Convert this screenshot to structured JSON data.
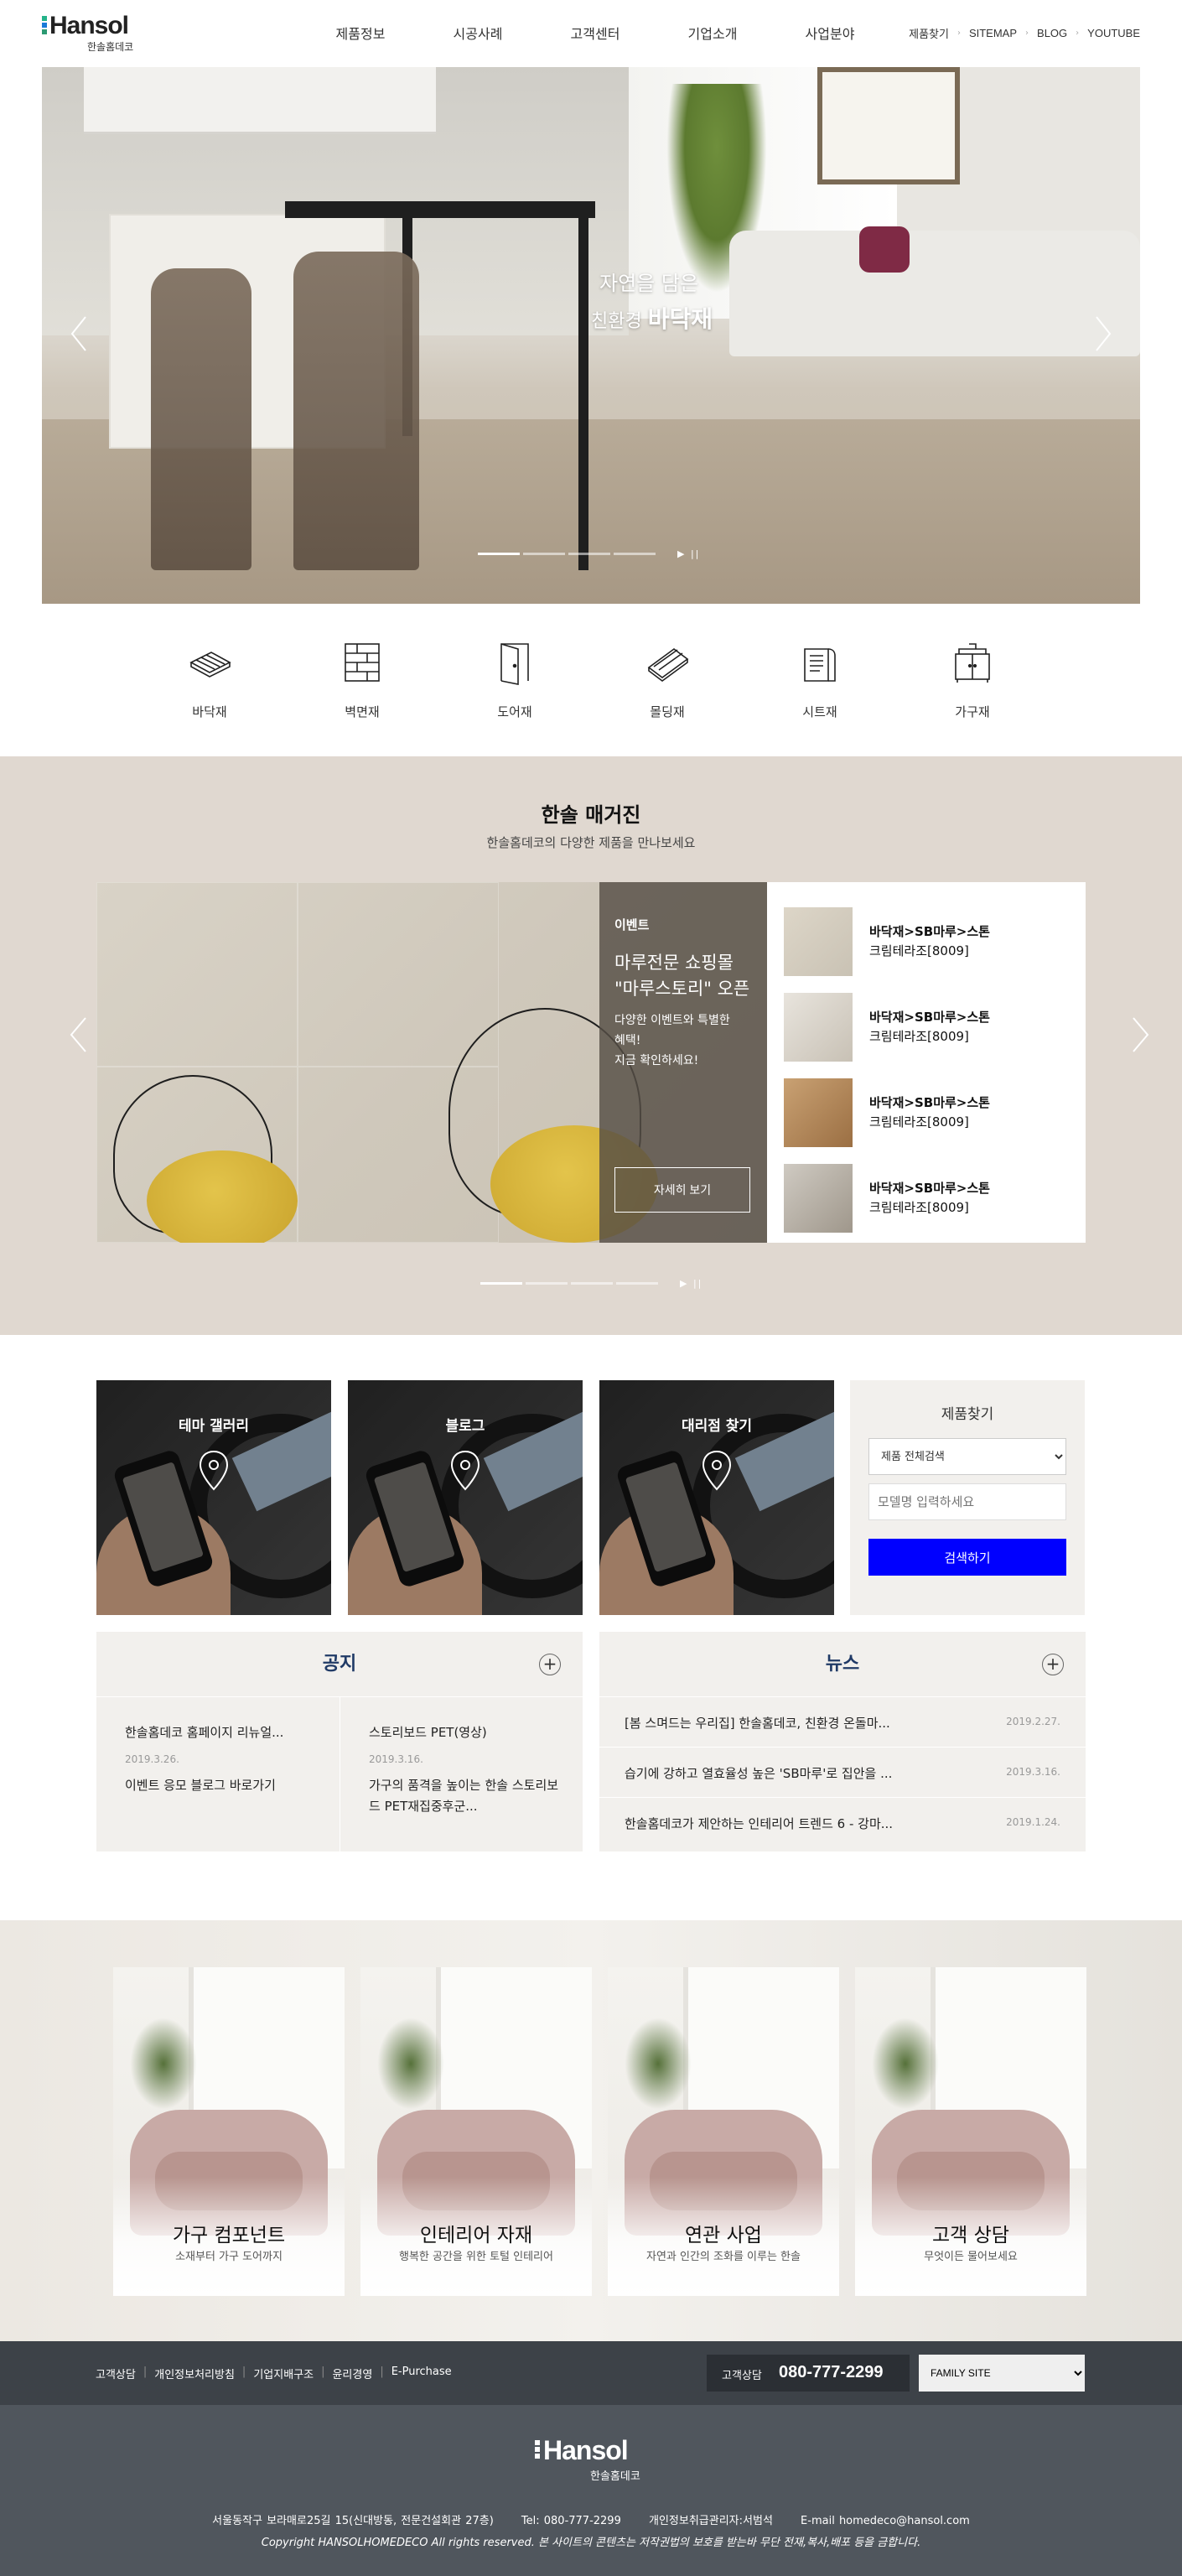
{
  "header": {
    "logo_text": "Hansol",
    "logo_sub": "한솔홈데코",
    "nav": [
      "제품정보",
      "시공사례",
      "고객센터",
      "기업소개",
      "사업분야"
    ],
    "util": [
      "제품찾기",
      "SITEMAP",
      "BLOG",
      "YOUTUBE"
    ]
  },
  "hero": {
    "line1": "자연을 담은",
    "line2_prefix": "친환경",
    "line2_strong": "바닥재",
    "slide_count": 4,
    "active_slide": 1,
    "controls": "▶ ||"
  },
  "categories": [
    {
      "label": "바닥재",
      "icon": "floor-icon"
    },
    {
      "label": "벽면재",
      "icon": "wall-icon"
    },
    {
      "label": "도어재",
      "icon": "door-icon"
    },
    {
      "label": "몰딩재",
      "icon": "molding-icon"
    },
    {
      "label": "시트재",
      "icon": "sheet-icon"
    },
    {
      "label": "가구재",
      "icon": "furniture-icon"
    }
  ],
  "magazine": {
    "title": "한솔 매거진",
    "subtitle": "한솔홈데코의 다양한 제품을 만나보세요",
    "feature": {
      "tag": "이벤트",
      "headline_1": "마루전문 쇼핑몰",
      "headline_2": "\"마루스토리\" 오픈",
      "desc_1": "다양한 이벤트와 특별한",
      "desc_2": "혜택!",
      "desc_3": "지금 확인하세요!",
      "button": "자세히 보기"
    },
    "items": [
      {
        "line1": "바닥재>SB마루>스톤",
        "line2": "크림테라조[8009]",
        "thumb": "#c9c2b4"
      },
      {
        "line1": "바닥재>SB마루>스톤",
        "line2": "크림테라조[8009]",
        "thumb": "#d8d3cb"
      },
      {
        "line1": "바닥재>SB마루>스톤",
        "line2": "크림테라조[8009]",
        "thumb": "#b3875a"
      },
      {
        "line1": "바닥재>SB마루>스톤",
        "line2": "크림테라조[8009]",
        "thumb": "#b8b2a8"
      }
    ],
    "slide_count": 4,
    "active_slide": 1,
    "controls": "▶ ||"
  },
  "quick_links": [
    {
      "label": "테마 갤러리"
    },
    {
      "label": "블로그"
    },
    {
      "label": "대리점 찾기"
    }
  ],
  "product_search": {
    "title": "제품찾기",
    "select_value": "제품 전체검색",
    "input_placeholder": "모델명 입력하세요",
    "button": "검색하기"
  },
  "notice": {
    "title": "공지",
    "items": [
      {
        "title": "한솔홈데코 홈페이지 리뉴얼...",
        "date": "2019.3.26."
      },
      {
        "title": "스토리보드 PET(영상)",
        "date": "2019.3.16."
      },
      {
        "title": "이벤트 응모 블로그 바로가기",
        "date": ""
      },
      {
        "title": "가구의 품격을 높이는 한솔 스토리보드 PET재집중후군...",
        "date": ""
      }
    ]
  },
  "news": {
    "title": "뉴스",
    "items": [
      {
        "title": "[봄 스며드는 우리집] 한솔홈데코, 친환경 온돌마...",
        "date": "2019.2.27."
      },
      {
        "title": "습기에 강하고 열효율성 높은 'SB마루'로 집안을 ...",
        "date": "2019.3.16."
      },
      {
        "title": "한솔홈데코가 제안하는 인테리어 트렌드 6 - 강마...",
        "date": "2019.1.24."
      }
    ]
  },
  "promos": [
    {
      "title": "가구 컴포넌트",
      "sub": "소재부터 가구 도어까지"
    },
    {
      "title": "인테리어 자재",
      "sub": "행복한 공간을 위한 토털 인테리어"
    },
    {
      "title": "연관 사업",
      "sub": "자연과 인간의 조화를 이루는 한솔"
    },
    {
      "title": "고객 상담",
      "sub": "무엇이든 물어보세요"
    }
  ],
  "footer": {
    "links": [
      "고객상담",
      "개인정보처리방침",
      "기업지배구조",
      "윤리경영",
      "E-Purchase"
    ],
    "call_label": "고객상담",
    "call_number": "080-777-2299",
    "family_site": "FAMILY SITE",
    "logo_text": "Hansol",
    "logo_sub": "한솔홈데코",
    "address": "서울동작구 보라매로25길 15(신대방동, 전문건설회관 27층)",
    "tel": "Tel: 080-777-2299",
    "privacy_officer": "개인정보취급관리자:서범석",
    "email": "E-mail homedeco@hansol.com",
    "copyright": "Copyright HANSOLHOMEDECO All rights reserved. 본 사이트의 콘텐츠는 저작권법의 보호를 받는바 무단 전재,복사,배포 등을 금합니다."
  }
}
